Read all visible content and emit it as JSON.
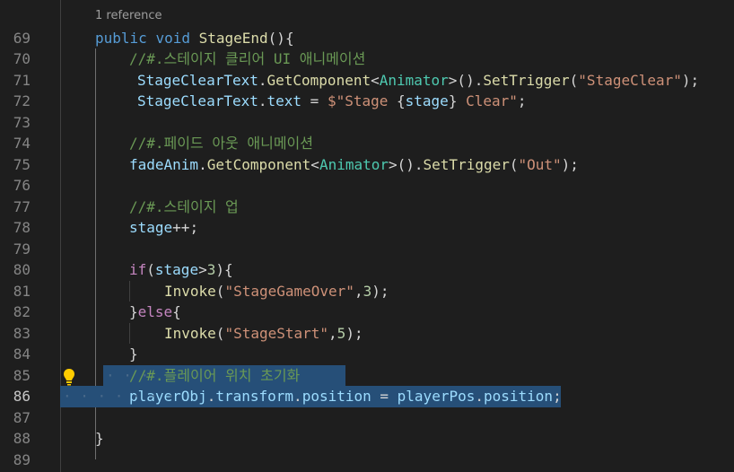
{
  "codelens": "1 reference",
  "active_line": "86",
  "lines": [
    {
      "n": "69",
      "tokens": [
        [
          "kw",
          "public"
        ],
        [
          "pun",
          " "
        ],
        [
          "kw",
          "void"
        ],
        [
          "pun",
          " "
        ],
        [
          "fn",
          "StageEnd"
        ],
        [
          "pun",
          "(){"
        ]
      ]
    },
    {
      "n": "70",
      "tokens": [
        [
          "cmt",
          "//#.스테이지 클리어 UI 애니메이션"
        ]
      ]
    },
    {
      "n": "71",
      "tokens": [
        [
          "var",
          "StageClearText"
        ],
        [
          "pun",
          "."
        ],
        [
          "fn",
          "GetComponent"
        ],
        [
          "pun",
          "<"
        ],
        [
          "typ",
          "Animator"
        ],
        [
          "pun",
          ">()."
        ],
        [
          "fn",
          "SetTrigger"
        ],
        [
          "pun",
          "("
        ],
        [
          "str",
          "\"StageClear\""
        ],
        [
          "pun",
          ");"
        ]
      ]
    },
    {
      "n": "72",
      "tokens": [
        [
          "var",
          "StageClearText"
        ],
        [
          "pun",
          "."
        ],
        [
          "var",
          "text"
        ],
        [
          "pun",
          " = "
        ],
        [
          "str",
          "$\"Stage "
        ],
        [
          "pun",
          "{"
        ],
        [
          "var",
          "stage"
        ],
        [
          "pun",
          "}"
        ],
        [
          "str",
          " Clear\""
        ],
        [
          "pun",
          ";"
        ]
      ]
    },
    {
      "n": "73",
      "tokens": []
    },
    {
      "n": "74",
      "tokens": [
        [
          "cmt",
          "//#.페이드 아웃 애니메이션"
        ]
      ]
    },
    {
      "n": "75",
      "tokens": [
        [
          "var",
          "fadeAnim"
        ],
        [
          "pun",
          "."
        ],
        [
          "fn",
          "GetComponent"
        ],
        [
          "pun",
          "<"
        ],
        [
          "typ",
          "Animator"
        ],
        [
          "pun",
          ">()."
        ],
        [
          "fn",
          "SetTrigger"
        ],
        [
          "pun",
          "("
        ],
        [
          "str",
          "\"Out\""
        ],
        [
          "pun",
          ");"
        ]
      ]
    },
    {
      "n": "76",
      "tokens": []
    },
    {
      "n": "77",
      "tokens": [
        [
          "cmt",
          "//#.스테이지 업"
        ]
      ]
    },
    {
      "n": "78",
      "tokens": [
        [
          "var",
          "stage"
        ],
        [
          "pun",
          "++;"
        ]
      ]
    },
    {
      "n": "79",
      "tokens": []
    },
    {
      "n": "80",
      "tokens": [
        [
          "ctl",
          "if"
        ],
        [
          "pun",
          "("
        ],
        [
          "var",
          "stage"
        ],
        [
          "pun",
          ">"
        ],
        [
          "num",
          "3"
        ],
        [
          "pun",
          "){"
        ]
      ]
    },
    {
      "n": "81",
      "tokens": [
        [
          "fn",
          "Invoke"
        ],
        [
          "pun",
          "("
        ],
        [
          "str",
          "\"StageGameOver\""
        ],
        [
          "pun",
          ","
        ],
        [
          "num",
          "3"
        ],
        [
          "pun",
          ");"
        ]
      ]
    },
    {
      "n": "82",
      "tokens": [
        [
          "pun",
          "}"
        ],
        [
          "ctl",
          "else"
        ],
        [
          "pun",
          "{"
        ]
      ]
    },
    {
      "n": "83",
      "tokens": [
        [
          "fn",
          "Invoke"
        ],
        [
          "pun",
          "("
        ],
        [
          "str",
          "\"StageStart\""
        ],
        [
          "pun",
          ","
        ],
        [
          "num",
          "5"
        ],
        [
          "pun",
          ");"
        ]
      ]
    },
    {
      "n": "84",
      "tokens": [
        [
          "pun",
          "}"
        ]
      ]
    },
    {
      "n": "85",
      "tokens": [
        [
          "cmt",
          "//#.플레이어 위치 초기화"
        ]
      ]
    },
    {
      "n": "86",
      "tokens": [
        [
          "var",
          "playerObj"
        ],
        [
          "pun",
          "."
        ],
        [
          "var",
          "transform"
        ],
        [
          "pun",
          "."
        ],
        [
          "var",
          "position"
        ],
        [
          "pun",
          " = "
        ],
        [
          "var",
          "playerPos"
        ],
        [
          "pun",
          "."
        ],
        [
          "var",
          "position"
        ],
        [
          "pun",
          ";"
        ]
      ]
    },
    {
      "n": "87",
      "tokens": []
    },
    {
      "n": "88",
      "tokens": [
        [
          "pun",
          "}"
        ]
      ]
    },
    {
      "n": "89",
      "tokens": []
    }
  ],
  "icons": {
    "lightbulb": "lightbulb-icon"
  },
  "colors": {
    "background": "#1e1e1e",
    "selection": "#264f78",
    "keyword": "#569cd6",
    "comment": "#6a9955",
    "string": "#ce9178",
    "type": "#4ec9b0",
    "function": "#dcdcaa",
    "variable": "#9cdcfe"
  }
}
